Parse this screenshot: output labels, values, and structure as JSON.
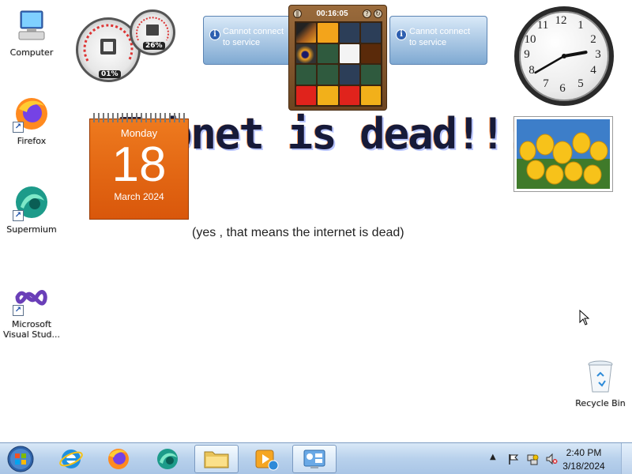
{
  "desktop": {
    "icons": [
      {
        "label": "Computer",
        "icon": "computer-icon"
      },
      {
        "label": "Firefox",
        "icon": "firefox-icon"
      },
      {
        "label": "Supermium",
        "icon": "supermium-icon"
      },
      {
        "label": "Microsoft Visual Stud...",
        "icon": "visual-studio-icon"
      },
      {
        "label": "Recycle Bin",
        "icon": "recycle-bin-icon"
      }
    ],
    "wallpaper_title": "Tabnet is dead!!!",
    "wallpaper_subtitle": "(yes , that means the internet is dead)"
  },
  "gadgets": {
    "cpu_meter": {
      "cpu_percent": "01%",
      "memory_percent": "26%"
    },
    "feed_left": {
      "message_line1": "Cannot connect",
      "message_line2": "to service"
    },
    "feed_right": {
      "message_line1": "Cannot connect",
      "message_line2": "to service"
    },
    "puzzle": {
      "timer": "00:16:05"
    },
    "calendar": {
      "weekday": "Monday",
      "day": "18",
      "month_year": "March 2024"
    },
    "clock": {
      "hour": 2,
      "minute": 40
    }
  },
  "taskbar": {
    "buttons": [
      {
        "name": "start-button",
        "icon": "windows-orb-icon"
      },
      {
        "name": "taskbar-internet-explorer",
        "icon": "internet-explorer-icon"
      },
      {
        "name": "taskbar-firefox",
        "icon": "firefox-icon"
      },
      {
        "name": "taskbar-supermium",
        "icon": "supermium-icon"
      },
      {
        "name": "taskbar-file-explorer",
        "icon": "folder-icon"
      },
      {
        "name": "taskbar-media-player",
        "icon": "media-player-icon"
      },
      {
        "name": "taskbar-gadgets",
        "icon": "gadgets-icon"
      }
    ],
    "tray": {
      "time": "2:40 PM",
      "date": "3/18/2024"
    }
  },
  "colors": {
    "taskbar": "#b8d1ec",
    "calendar": "#e66a14",
    "wallpaper_text": "#161a3a"
  }
}
